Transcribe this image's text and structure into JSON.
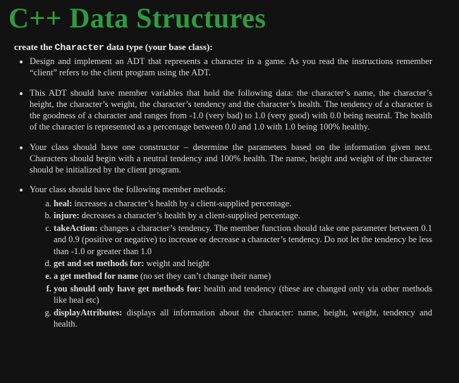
{
  "title": "C++ Data Structures",
  "intro": {
    "prefix": "create the ",
    "code": "Character",
    "suffix": " data type (your base class):"
  },
  "bullets": [
    "Design and implement an ADT that represents a character in a game.  As you read the instructions remember “client” refers to the client program using the ADT.",
    "This ADT should have member variables that hold the following data:  the character’s name, the character’s height, the character’s weight, the character’s tendency and the character’s health.  The tendency of a character is the goodness of a character and ranges from -1.0 (very bad) to 1.0 (very good) with 0.0 being neutral.  The health of the character is represented as a percentage between 0.0 and 1.0 with 1.0 being 100% healthy.",
    "Your class should have one constructor – determine the parameters based on the information given next.  Characters should begin with a neutral tendency and 100% health.  The name, height and weight of the character should be initialized by the client program.",
    "Your class should have the following member methods:"
  ],
  "methods": [
    {
      "name": "heal:",
      "desc": "  increases a character’s health by a client-supplied percentage."
    },
    {
      "name": "injure:",
      "desc": "  decreases a character’s health by a client-supplied percentage."
    },
    {
      "name": "takeAction:",
      "desc": "  changes a character’s tendency.  The member function should take one parameter between 0.1 and 0.9 (positive or negative) to increase or decrease a character’s tendency.  Do not let the tendency be less than -1.0 or greater than 1.0"
    },
    {
      "name": "get and set methods for:",
      "desc": "  weight and height"
    },
    {
      "name": "a get method for name",
      "desc": " (no set they can’t change their name)",
      "boldMarker": true
    },
    {
      "name": "you should only have get methods for:",
      "desc": "  health and tendency (these are changed only via other methods like heal etc)",
      "boldMarker": true
    },
    {
      "name": "displayAttributes:",
      "desc": "  displays all information about the character:  name, height, weight, tendency and health."
    }
  ]
}
